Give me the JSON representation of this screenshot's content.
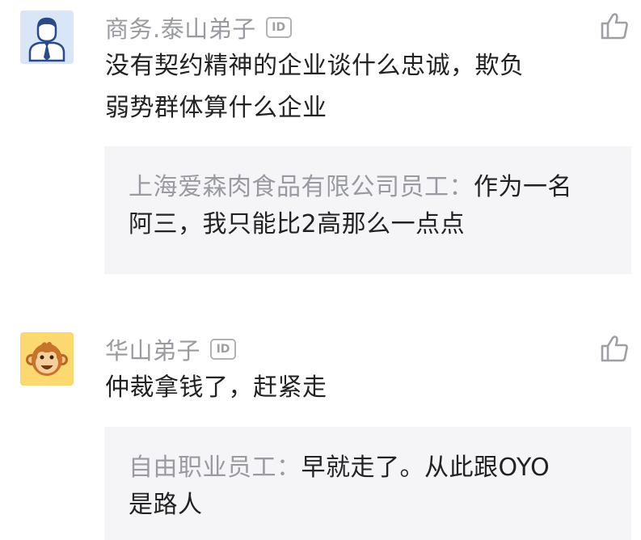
{
  "comments": [
    {
      "username": "商务.泰山弟子",
      "id_badge": "ID",
      "avatar_icon": "businessman-avatar-icon",
      "text_line1": "没有契约精神的企业谈什么忠诚，欺负",
      "text_line2": "弱势群体算什么企业",
      "reply": {
        "author": "上海爱森肉食品有限公司员工：",
        "text_line1": "作为一名",
        "text_line2": "阿三，我只能比2高那么一点点"
      }
    },
    {
      "username": "华山弟子",
      "id_badge": "ID",
      "avatar_icon": "monkey-avatar-icon",
      "text_line1": "仲裁拿钱了，赶紧走",
      "reply": {
        "author": "自由职业员工：",
        "text_line1": "早就走了。从此跟OYO",
        "text_line2": "是路人"
      }
    }
  ],
  "colors": {
    "username": "#9a9ba2",
    "text": "#222222",
    "quote_bg": "#f5f5f7",
    "avatar1_bg": "#d8e6f7",
    "avatar2_bg": "#fbd970"
  }
}
